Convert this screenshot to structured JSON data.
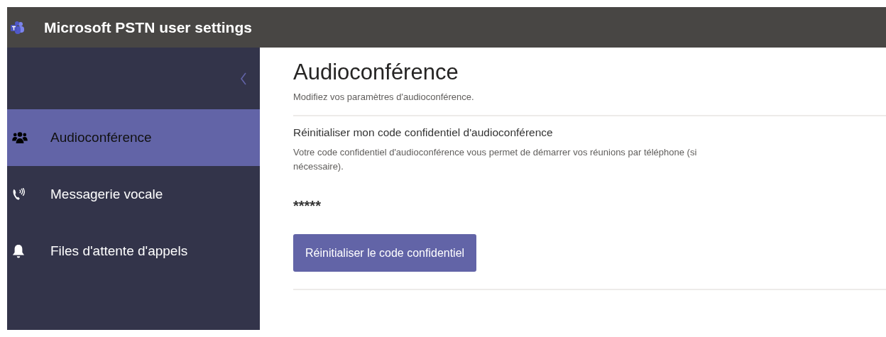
{
  "window": {
    "title": "Microsoft PSTN user settings"
  },
  "sidebar": {
    "items": [
      {
        "label": "Audioconférence",
        "kind": "people",
        "selected": true
      },
      {
        "label": "Messagerie vocale",
        "kind": "phone",
        "selected": false
      },
      {
        "label": "Files d'attente d'appels",
        "kind": "bell",
        "selected": false
      }
    ]
  },
  "page": {
    "heading": "Audioconférence",
    "subtitle": "Modifiez vos paramètres d'audioconférence.",
    "section": {
      "heading": "Réinitialiser mon code confidentiel d'audioconférence",
      "description": "Votre code confidentiel d'audioconférence vous permet de démarrer vos réunions par téléphone (si nécessaire).",
      "pin": "*****",
      "button": "Réinitialiser le code confidentiel"
    }
  }
}
